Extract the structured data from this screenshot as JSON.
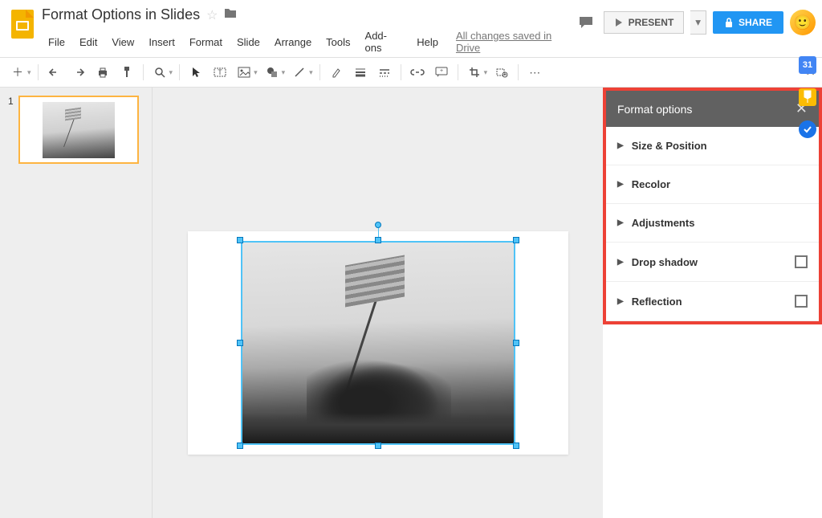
{
  "doc_title": "Format Options in Slides",
  "menus": [
    "File",
    "Edit",
    "View",
    "Insert",
    "Format",
    "Slide",
    "Arrange",
    "Tools",
    "Add-ons",
    "Help"
  ],
  "saved_status": "All changes saved in Drive",
  "present_label": "PRESENT",
  "share_label": "SHARE",
  "slide_number": "1",
  "format_panel": {
    "title": "Format options",
    "options": [
      {
        "label": "Size & Position",
        "has_checkbox": false
      },
      {
        "label": "Recolor",
        "has_checkbox": false
      },
      {
        "label": "Adjustments",
        "has_checkbox": false
      },
      {
        "label": "Drop shadow",
        "has_checkbox": true
      },
      {
        "label": "Reflection",
        "has_checkbox": true
      }
    ]
  }
}
